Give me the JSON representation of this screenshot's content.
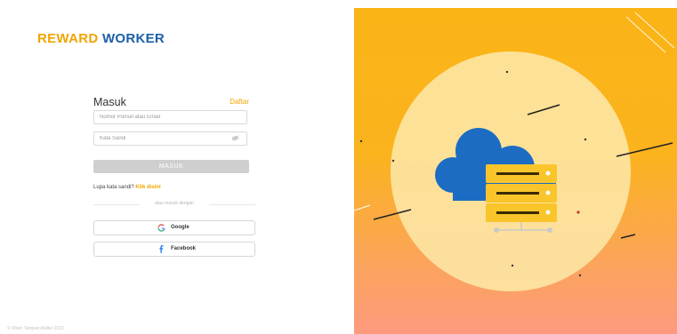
{
  "brand": {
    "part1": "REWARD",
    "part2": "WORKER"
  },
  "login": {
    "title": "Masuk",
    "register_link": "Daftar",
    "identifier_placeholder": "Nomor Ponsel atau Email",
    "password_placeholder": "Kata Sandi",
    "submit_label": "MASUK",
    "forgot_text": "Lupa kata sandi?",
    "forgot_link": "Klik disini",
    "divider_text": "atau masuk dengan",
    "google_label": "Google",
    "facebook_label": "Facebook"
  },
  "footer": {
    "copyright": "© Wisin Tampan Abiller 2022"
  },
  "icons": {
    "google": "google-icon",
    "facebook": "facebook-icon",
    "password_toggle": "eye-slash-icon",
    "illustration": "cloud-server-icon"
  },
  "colors": {
    "brand_primary": "#f0a500",
    "brand_secondary": "#1d5fa8",
    "panel_top": "#fbb416",
    "panel_bottom": "#fd9a7e",
    "cloud": "#1d6cc4",
    "server": "#f9c52b"
  }
}
